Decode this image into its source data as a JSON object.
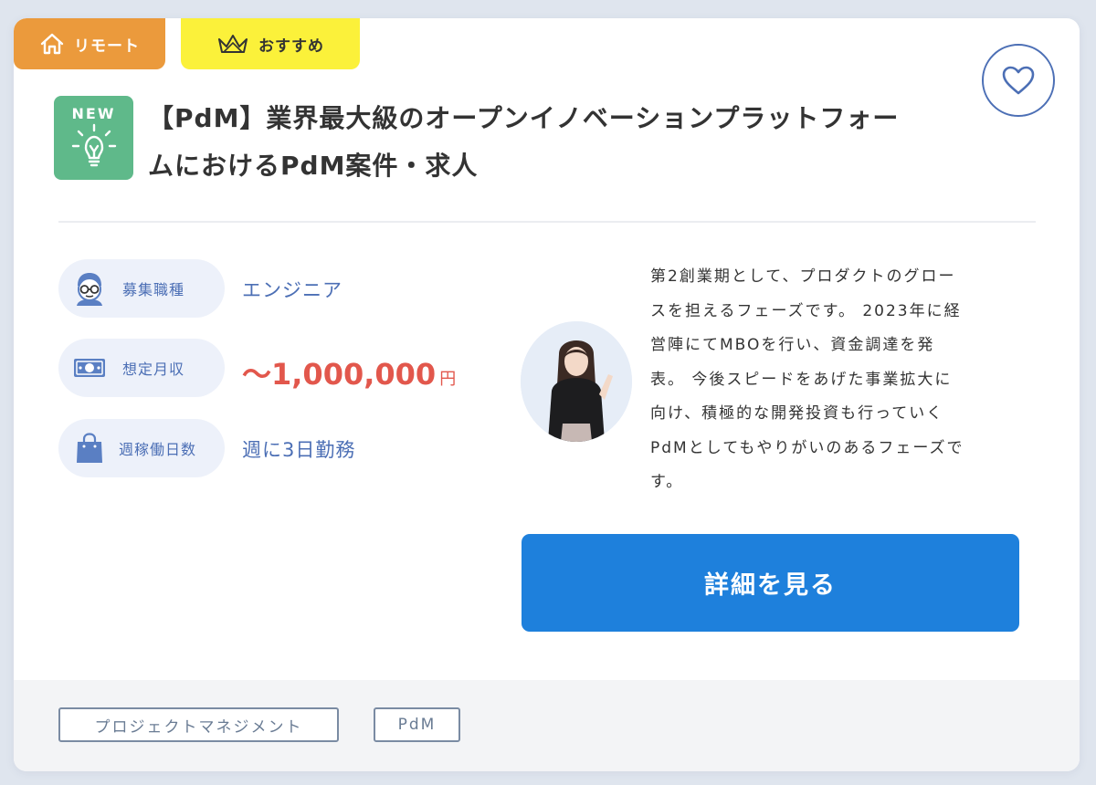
{
  "badges": {
    "remote": "リモート",
    "recommended": "おすすめ"
  },
  "new_label": "NEW",
  "job": {
    "title_line1": "【PdM】業界最大級のオープンイノベーションプラットフォー",
    "title_line2": "ムにおけるPdM案件・求人"
  },
  "details": [
    {
      "label": "募集職種",
      "value": "エンジニア",
      "icon": "engineer-face-icon"
    },
    {
      "label": "想定月収",
      "value": "〜1,000,000",
      "unit": "円",
      "icon": "money-icon"
    },
    {
      "label": "週稼働日数",
      "value": "週に3日勤務",
      "icon": "bag-icon"
    }
  ],
  "description_lines": [
    "第2創業期として、プロダクトのグロー",
    "スを担えるフェーズです。 2023年に経",
    "営陣にてMBOを行い、資金調達を発",
    "表。 今後スピードをあげた事業拡大に",
    "向け、積極的な開発投資も行っていく",
    "PdMとしてもやりがいのあるフェーズで",
    "す。"
  ],
  "button": {
    "detail": "詳細を見る"
  },
  "tags": [
    "プロジェクトマネジメント",
    "PdM"
  ],
  "colors": {
    "remote_badge": "#eb9a3c",
    "recommended_badge": "#fbf13a",
    "new_icon_bg": "#5fb98a",
    "accent_blue": "#4c6fb5",
    "salary_red": "#e2574c",
    "button_blue": "#1e80dc"
  }
}
